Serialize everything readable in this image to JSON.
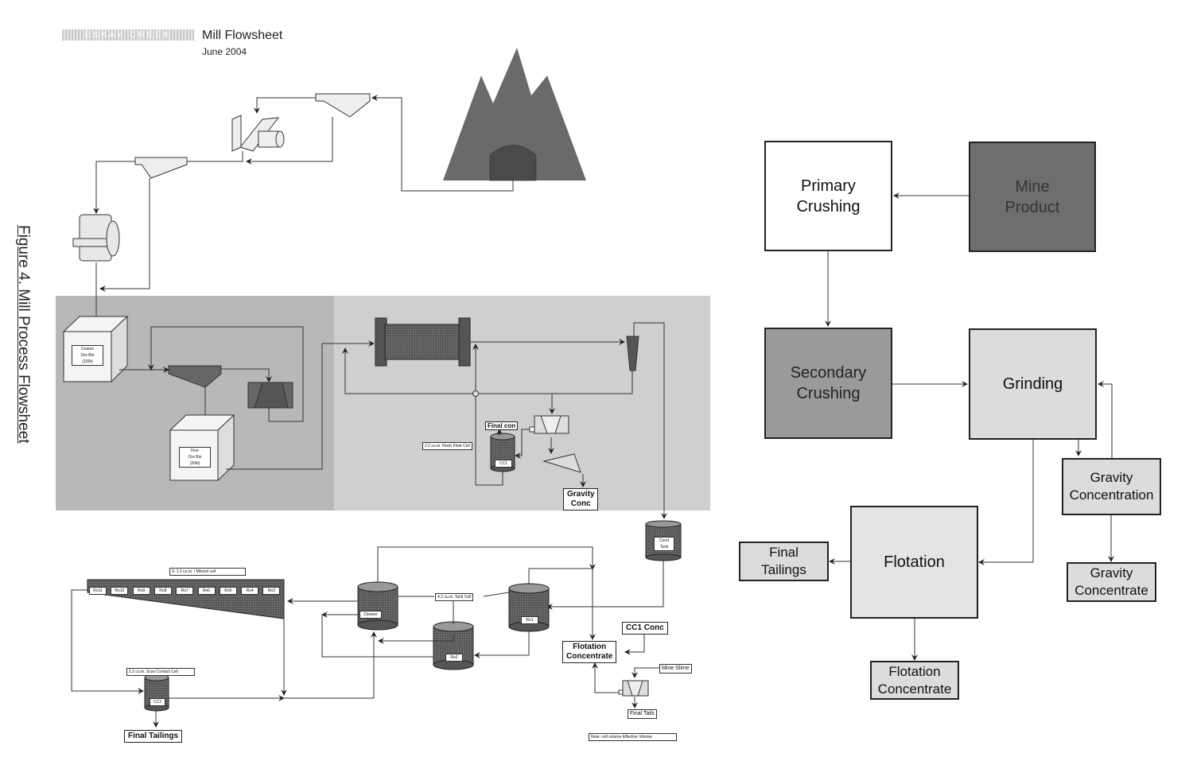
{
  "caption": "Figure 4.  Mill Process Flowsheet",
  "header": {
    "logo_text": "ESKAY CREEK",
    "title": "Mill Flowsheet",
    "date": "June 2004"
  },
  "detailed_flowsheet": {
    "coarse_ore_bin": [
      "Coarse",
      "Ore Bin",
      "(150t)"
    ],
    "fine_ore_bin": [
      "Fine",
      "Ore Bin",
      "(20kt)"
    ],
    "flash_float_label": "2.2 cu.m. Flash Float Cell",
    "final_con": "Final con",
    "cc1": "CC1",
    "gravity_conc": [
      "Gravity",
      "Conc"
    ],
    "cond_tank": [
      "Cond",
      "Tank"
    ],
    "minicell_label": "9- 1.2 cu.m. / Minicel cell",
    "minicells": [
      "Ro11",
      "Ro10",
      "Ro9",
      "Ro8",
      "Ro7",
      "Ro6",
      "Ro5",
      "Ro4",
      "Ro3"
    ],
    "tank_cell_label": "4.2 cu.m. Tank Cell",
    "cleaner": "Cleaner",
    "ro1": "Ro1",
    "ro2": "Ro2",
    "cc1_conc": "CC1 Conc",
    "flotation_concentrate": [
      "Flotation",
      "Concentrate"
    ],
    "mine_slime": "Mine Slime",
    "final_tails": "Final Tails",
    "note": "Note: cell volume Effective Volume",
    "contact_cell_label": "2.2 cu.m. Scav Contact Cell",
    "cc2": "CC2",
    "final_tailings": "Final Tailings"
  },
  "block_diagram": {
    "primary_crushing": [
      "Primary",
      "Crushing"
    ],
    "mine_product": [
      "Mine",
      "Product"
    ],
    "secondary_crushing": [
      "Secondary",
      "Crushing"
    ],
    "grinding": "Grinding",
    "gravity_concentration": [
      "Gravity",
      "Concentration"
    ],
    "gravity_concentrate": [
      "Gravity",
      "Concentrate"
    ],
    "flotation": "Flotation",
    "final_tailings": [
      "Final",
      "Tailings"
    ],
    "flotation_concentrate": [
      "Flotation",
      "Concentrate"
    ]
  }
}
